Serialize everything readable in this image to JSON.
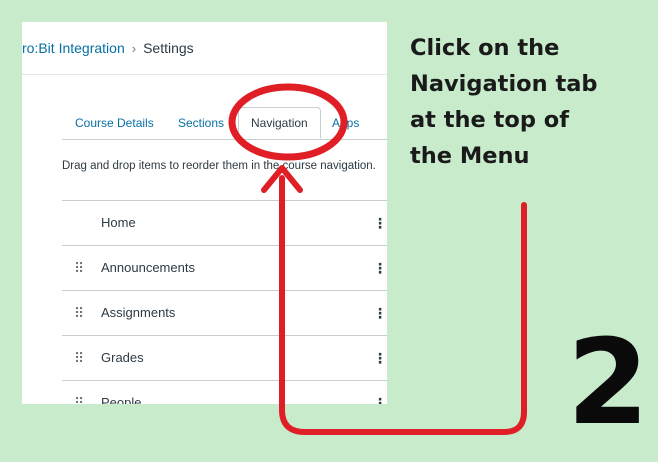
{
  "breadcrumb": {
    "course": "ro:Bit Integration",
    "separator": "›",
    "current": "Settings"
  },
  "tabs": [
    {
      "label": "Course Details",
      "active": false
    },
    {
      "label": "Sections",
      "active": false
    },
    {
      "label": "Navigation",
      "active": true
    },
    {
      "label": "Apps",
      "active": false
    }
  ],
  "instruction": "Drag and drop items to reorder them in the course navigation.",
  "nav_items": [
    {
      "label": "Home",
      "draggable": false
    },
    {
      "label": "Announcements",
      "draggable": true
    },
    {
      "label": "Assignments",
      "draggable": true
    },
    {
      "label": "Grades",
      "draggable": true
    },
    {
      "label": "People",
      "draggable": true
    }
  ],
  "callout": {
    "line1": "Click on the",
    "line2": "Navigation tab",
    "line3": "at  the top of",
    "line4": "the Menu"
  },
  "step_number": "2",
  "colors": {
    "background": "#c8ebcb",
    "annotation": "#e01e26",
    "link": "#0770a3",
    "text": "#2d3b45"
  },
  "icons": {
    "drag_handle": "⠿",
    "kebab": "⋮"
  }
}
